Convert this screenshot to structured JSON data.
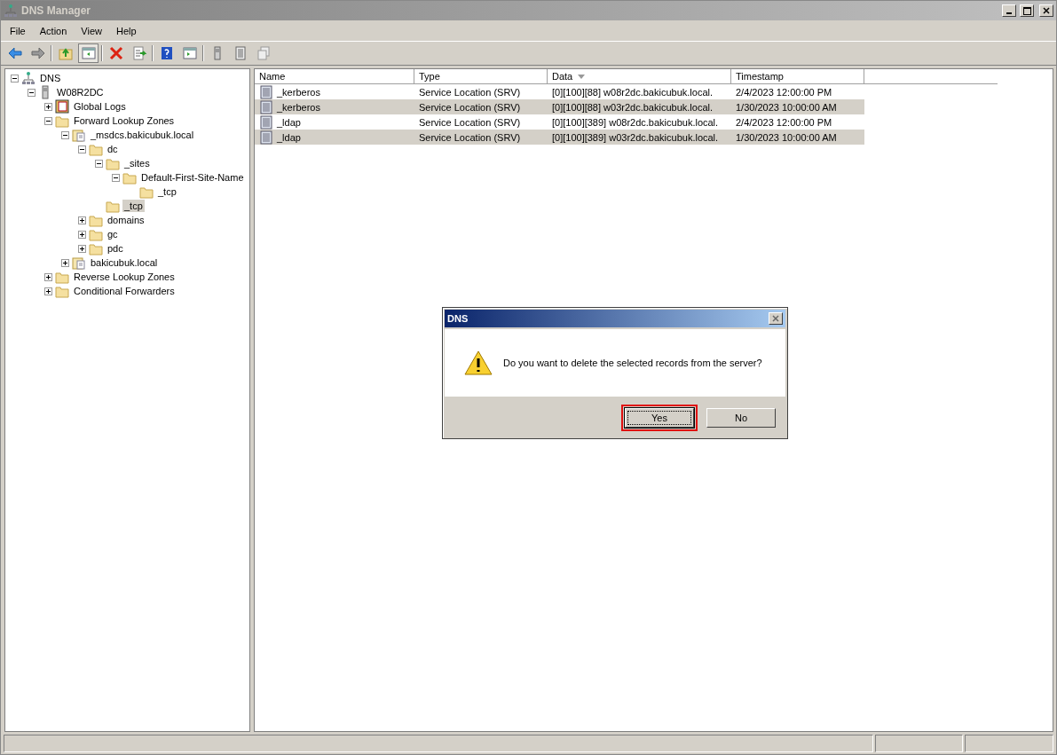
{
  "window": {
    "title": "DNS Manager"
  },
  "menu": [
    "File",
    "Action",
    "View",
    "Help"
  ],
  "toolbar": [
    {
      "kind": "back"
    },
    {
      "kind": "forward"
    },
    {
      "kind": "sep"
    },
    {
      "kind": "up"
    },
    {
      "kind": "pane",
      "selected": true
    },
    {
      "kind": "sep"
    },
    {
      "kind": "delete"
    },
    {
      "kind": "export"
    },
    {
      "kind": "sep"
    },
    {
      "kind": "help"
    },
    {
      "kind": "pane2"
    },
    {
      "kind": "sep"
    },
    {
      "kind": "server"
    },
    {
      "kind": "list"
    },
    {
      "kind": "copy"
    }
  ],
  "tree": [
    {
      "label": "DNS",
      "kind": "dns",
      "expanded": true,
      "selected": false,
      "children": [
        {
          "label": "W08R2DC",
          "kind": "server",
          "expanded": true,
          "selected": false,
          "children": [
            {
              "label": "Global Logs",
              "kind": "log",
              "expanded": false,
              "selected": false
            },
            {
              "label": "Forward Lookup Zones",
              "kind": "folder",
              "expanded": true,
              "selected": false,
              "children": [
                {
                  "label": "_msdcs.bakicubuk.local",
                  "kind": "zone",
                  "expanded": true,
                  "selected": false,
                  "children": [
                    {
                      "label": "dc",
                      "kind": "folder",
                      "expanded": true,
                      "selected": false,
                      "children": [
                        {
                          "label": "_sites",
                          "kind": "folder",
                          "expanded": true,
                          "selected": false,
                          "children": [
                            {
                              "label": "Default-First-Site-Name",
                              "kind": "folder",
                              "expanded": true,
                              "selected": false,
                              "children": [
                                {
                                  "label": "_tcp",
                                  "kind": "folder",
                                  "selected": false
                                }
                              ]
                            }
                          ]
                        },
                        {
                          "label": "_tcp",
                          "kind": "folder",
                          "selected": true
                        }
                      ]
                    },
                    {
                      "label": "domains",
                      "kind": "folder",
                      "expanded": false,
                      "selected": false
                    },
                    {
                      "label": "gc",
                      "kind": "folder",
                      "expanded": false,
                      "selected": false
                    },
                    {
                      "label": "pdc",
                      "kind": "folder",
                      "expanded": false,
                      "selected": false
                    }
                  ]
                },
                {
                  "label": "bakicubuk.local",
                  "kind": "zone",
                  "expanded": false,
                  "selected": false
                }
              ]
            },
            {
              "label": "Reverse Lookup Zones",
              "kind": "folder",
              "expanded": false,
              "selected": false
            },
            {
              "label": "Conditional Forwarders",
              "kind": "folder",
              "expanded": false,
              "selected": false
            }
          ]
        }
      ]
    }
  ],
  "table": {
    "columns": [
      {
        "label": "Name",
        "sorted": false
      },
      {
        "label": "Type",
        "sorted": false
      },
      {
        "label": "Data",
        "sorted": true
      },
      {
        "label": "Timestamp",
        "sorted": false
      }
    ],
    "rows": [
      {
        "cells": [
          "_kerberos",
          "Service Location (SRV)",
          "[0][100][88] w08r2dc.bakicubuk.local.",
          "2/4/2023 12:00:00 PM"
        ],
        "selected": false
      },
      {
        "cells": [
          "_kerberos",
          "Service Location (SRV)",
          "[0][100][88] w03r2dc.bakicubuk.local.",
          "1/30/2023 10:00:00 AM"
        ],
        "selected": true
      },
      {
        "cells": [
          "_ldap",
          "Service Location (SRV)",
          "[0][100][389] w08r2dc.bakicubuk.local.",
          "2/4/2023 12:00:00 PM"
        ],
        "selected": false
      },
      {
        "cells": [
          "_ldap",
          "Service Location (SRV)",
          "[0][100][389] w03r2dc.bakicubuk.local.",
          "1/30/2023 10:00:00 AM"
        ],
        "selected": true
      }
    ]
  },
  "dialog": {
    "title": "DNS",
    "message": "Do you want to delete the selected records from the server?",
    "buttons": [
      {
        "label": "Yes",
        "focused": true,
        "highlighted": true
      },
      {
        "label": "No",
        "focused": false,
        "highlighted": false
      }
    ]
  }
}
